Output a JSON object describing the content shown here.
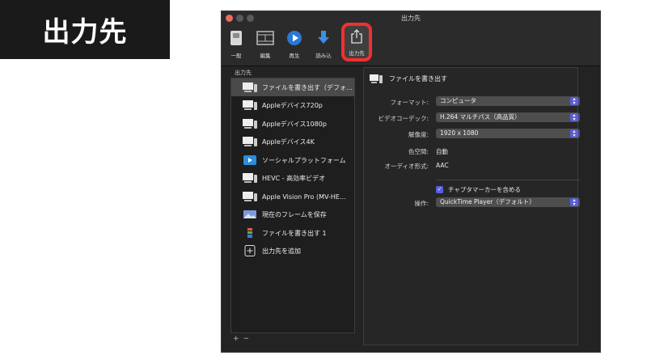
{
  "banner": {
    "title": "出力先"
  },
  "window": {
    "title": "出力先"
  },
  "toolbar": {
    "items": [
      {
        "label": "一般",
        "icon": "switch-icon"
      },
      {
        "label": "編集",
        "icon": "film-icon"
      },
      {
        "label": "再生",
        "icon": "play-icon"
      },
      {
        "label": "読み込",
        "icon": "download-icon"
      },
      {
        "label": "出力先",
        "icon": "share-icon"
      }
    ]
  },
  "sidebar": {
    "header": "出力先",
    "items": [
      {
        "label": "ファイルを書き出す（デフォ…",
        "icon": "computer-icon"
      },
      {
        "label": "Appleデバイス720p",
        "icon": "devices-icon"
      },
      {
        "label": "Appleデバイス1080p",
        "icon": "devices-icon"
      },
      {
        "label": "Appleデバイス4K",
        "icon": "devices-icon"
      },
      {
        "label": "ソーシャルプラットフォーム",
        "icon": "social-icon"
      },
      {
        "label": "HEVC - 高効率ビデオ",
        "icon": "computer-icon"
      },
      {
        "label": "Apple Vision Pro (MV-HE…",
        "icon": "computer-icon"
      },
      {
        "label": "現在のフレームを保存",
        "icon": "image-icon"
      },
      {
        "label": "ファイルを書き出す 1",
        "icon": "film-strip-icon"
      },
      {
        "label": "出力先を追加",
        "icon": "plus-icon"
      }
    ],
    "footer": {
      "add": "+",
      "remove": "−"
    }
  },
  "detail": {
    "title": "ファイルを書き出す",
    "format_label": "フォーマット:",
    "format_value": "コンピュータ",
    "codec_label": "ビデオコーデック:",
    "codec_value": "H.264 マルチパス（高品質）",
    "resolution_label": "解像度:",
    "resolution_value": "1920 x 1080",
    "colorspace_label": "色空間:",
    "colorspace_value": "自動",
    "audio_label": "オーディオ形式:",
    "audio_value": "AAC",
    "chapter_label": "チャプタマーカーを含める",
    "action_label": "操作:",
    "action_value": "QuickTime Player（デフォルト）"
  },
  "colors": {
    "accent": "#5a5ee0",
    "highlight": "#f03030",
    "background": "#232323"
  }
}
